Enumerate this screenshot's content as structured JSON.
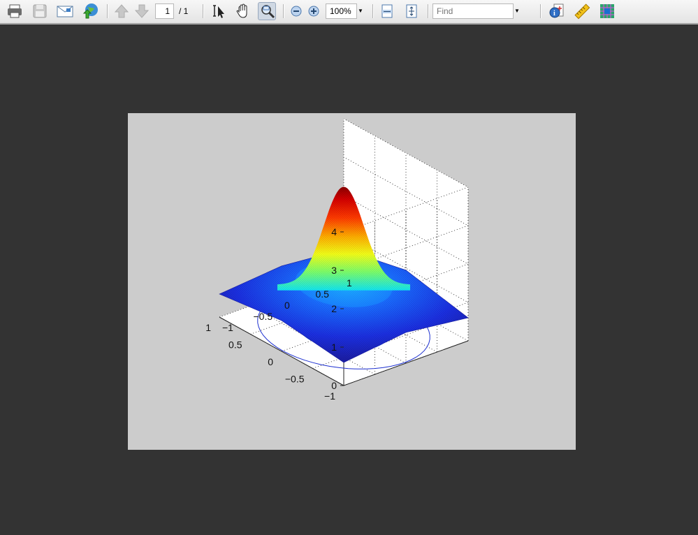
{
  "toolbar": {
    "page_input": "1",
    "page_total": "/ 1",
    "zoom": "100%",
    "find_placeholder": "Find",
    "icons": [
      "print-icon",
      "save-icon",
      "email-icon",
      "web-icon",
      "prev-page-icon",
      "next-page-icon",
      "select-text-icon",
      "hand-icon",
      "zoom-tool-icon",
      "zoom-out-icon",
      "zoom-in-icon",
      "fit-width-icon",
      "fit-page-icon",
      "document-properties-icon",
      "measure-icon",
      "grid-icon"
    ]
  },
  "chart_data": {
    "type": "surface",
    "z_ticks": [
      "0",
      "1",
      "2",
      "3",
      "4"
    ],
    "x_ticks": [
      "-1",
      "-0.5",
      "0",
      "0.5",
      "1"
    ],
    "y_ticks": [
      "1",
      "0.5",
      "0",
      "-0.5",
      "-1"
    ],
    "zlim": [
      0,
      4
    ],
    "xlim": [
      -1,
      1
    ],
    "ylim": [
      -1,
      1
    ],
    "peak_value": 3.7,
    "edge_value": 0.6,
    "grid": "dotted",
    "colormap": "jet",
    "contour_levels": 2,
    "background": "#cccccc"
  }
}
